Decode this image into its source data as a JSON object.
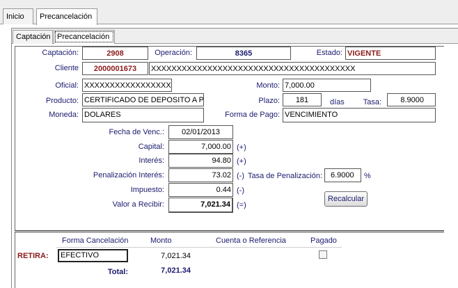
{
  "tabs": [
    "Inicio",
    "Precancelación"
  ],
  "subtabs": [
    "Captación",
    "Precancelación"
  ],
  "header": {
    "captacion_label": "Captación:",
    "captacion_value": "2908",
    "operacion_label": "Operación:",
    "operacion_value": "8365",
    "estado_label": "Estado:",
    "estado_value": "VIGENTE",
    "cliente_label": "Cliente",
    "cliente_code": "2000001673",
    "cliente_name": "XXXXXXXXXXXXXXXXXXXXXXXXXXXXXXXXXXXXXXXX",
    "oficial_label": "Oficial:",
    "oficial_value": "XXXXXXXXXXXXXXXXXXXXXXX",
    "monto_label": "Monto:",
    "monto_value": "7,000.00",
    "producto_label": "Producto:",
    "producto_value": "CERTIFICADO DE DEPOSITO A PLAZ",
    "plazo_label": "Plazo:",
    "plazo_value": "181",
    "dias_label": "días",
    "tasa_label": "Tasa:",
    "tasa_value": "8.9000",
    "moneda_label": "Moneda:",
    "moneda_value": "DOLARES",
    "forma_pago_label": "Forma de Pago:",
    "forma_pago_value": "VENCIMIENTO"
  },
  "calc": {
    "fecha_venc_label": "Fecha de Venc.:",
    "fecha_venc_value": "02/01/2013",
    "capital_label": "Capital:",
    "capital_value": "7,000.00",
    "capital_sign": "(+)",
    "interes_label": "Interés:",
    "interes_value": "94.80",
    "interes_sign": "(+)",
    "penalizacion_label": "Penalización Interés:",
    "penalizacion_value": "73.02",
    "penalizacion_sign": "(-)",
    "tasa_pen_label": "Tasa de Penalización:",
    "tasa_pen_value": "6.9000",
    "tasa_pen_unit": "%",
    "impuesto_label": "Impuesto:",
    "impuesto_value": "0.44",
    "impuesto_sign": "(-)",
    "valor_label": "Valor a Recibir:",
    "valor_value": "7,021.34",
    "valor_sign": "(=)",
    "recalcular_label": "Recalcular"
  },
  "cancel_table": {
    "columns": [
      "Forma Cancelación",
      "Monto",
      "Cuenta o Referencia",
      "Pagado"
    ],
    "retira_label": "RETIRA:",
    "row": {
      "forma": "EFECTIVO",
      "monto": "7,021.34",
      "referencia": "",
      "pagado": false
    },
    "total_label": "Total:",
    "total_value": "7,021.34"
  },
  "colors": {
    "label": "#1a1a6e",
    "accent_red": "#8b1a1a"
  }
}
